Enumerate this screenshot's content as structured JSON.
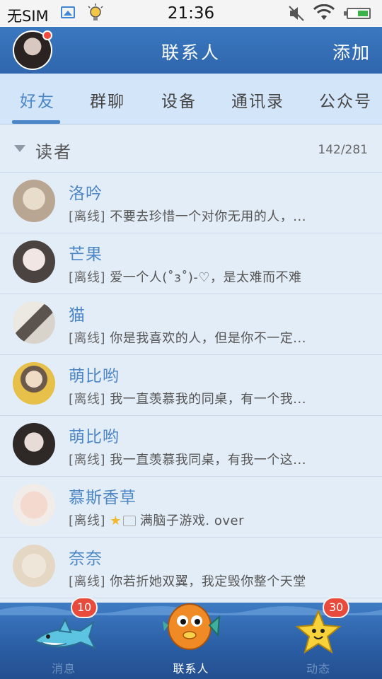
{
  "status_bar": {
    "carrier": "无SIM",
    "time": "21:36",
    "battery_level": 0.55
  },
  "header": {
    "title": "联系人",
    "add_label": "添加"
  },
  "tabs": [
    {
      "label": "好友",
      "active": true
    },
    {
      "label": "群聊",
      "active": false
    },
    {
      "label": "设备",
      "active": false
    },
    {
      "label": "通讯录",
      "active": false
    },
    {
      "label": "公众号",
      "active": false
    }
  ],
  "group": {
    "name": "读者",
    "count": "142/281"
  },
  "contacts": [
    {
      "name": "洛吟",
      "tag": "[离线]",
      "text": "不要去珍惜一个对你无用的人，..."
    },
    {
      "name": "芒果",
      "tag": "[离线]",
      "text": "爱一个人(˚з˚)-♡，是太难而不难"
    },
    {
      "name": "猫",
      "tag": "[离线]",
      "text": "你是我喜欢的人，但是你不一定..."
    },
    {
      "name": "萌比哟",
      "tag": "[离线]",
      "text": "我一直羡慕我的同桌，有一个我..."
    },
    {
      "name": "萌比哟",
      "tag": "[离线]",
      "text": "我一直羡慕我同桌，有我一个这..."
    },
    {
      "name": "慕斯香草",
      "tag": "[离线]",
      "text": "满脑子游戏.    over"
    },
    {
      "name": "奈奈",
      "tag": "[离线]",
      "text": "你若折她双翼，我定毁你整个天堂"
    }
  ],
  "bottom_nav": [
    {
      "label": "消息",
      "badge": "10",
      "icon": "shark-icon"
    },
    {
      "label": "联系人",
      "badge": "",
      "icon": "fish-icon"
    },
    {
      "label": "动态",
      "badge": "30",
      "icon": "starfish-icon"
    }
  ],
  "colors": {
    "header_blue": "#3370b5",
    "accent": "#4a86c7",
    "badge_red": "#e84a3c"
  }
}
